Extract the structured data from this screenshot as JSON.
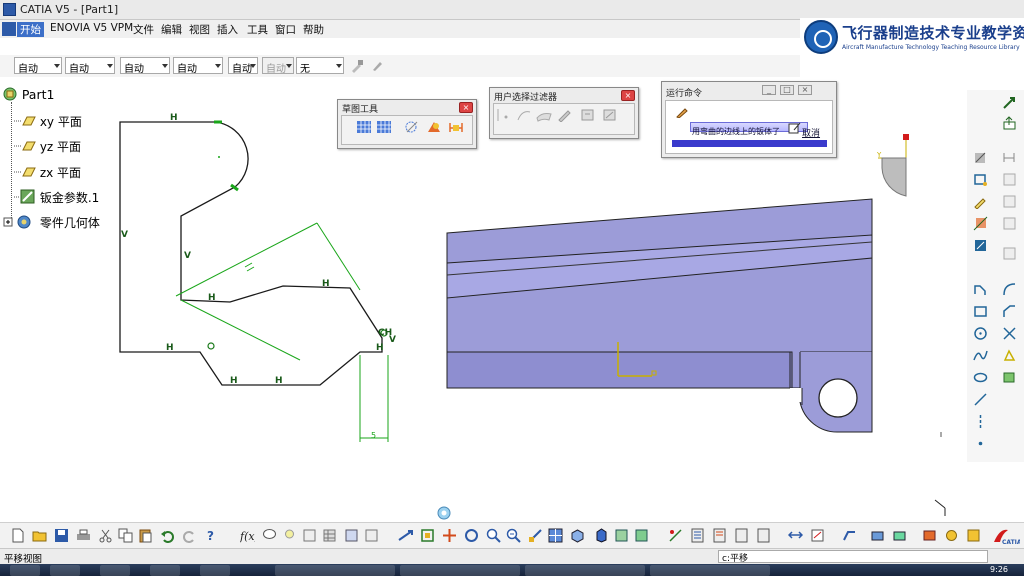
{
  "window": {
    "title": "CATIA V5 - [Part1]"
  },
  "menu": {
    "items": [
      "开始",
      "ENOVIA V5 VPM",
      "文件",
      "编辑",
      "视图",
      "插入",
      "工具",
      "窗口",
      "帮助"
    ]
  },
  "logo": {
    "text_cn": "飞行器制造技术专业教学资源库",
    "text_en": "Aircraft Manufacture Technology Teaching Resource Library"
  },
  "toolbar_top": {
    "combos": [
      "自动",
      "自动",
      "自动",
      "自动",
      "自动",
      "自动",
      "自动",
      "无"
    ]
  },
  "tree": {
    "root": "Part1",
    "items": [
      "xy 平面",
      "yz 平面",
      "zx 平面",
      "钣金参数.1",
      "零件几何体"
    ]
  },
  "sketch_tools": {
    "title": "草图工具"
  },
  "user_filter": {
    "title": "用户选择过滤器"
  },
  "run_command": {
    "title": "运行命令",
    "progress_text": "用弯曲的边线上的钣体了",
    "cancel_label": "取消"
  },
  "sketch": {
    "constraint_labels": [
      "H",
      "V",
      "V",
      "H",
      "H",
      "H",
      "H",
      "H",
      "H",
      "V",
      "H",
      "CH"
    ],
    "dimension": "5"
  },
  "statusbar": {
    "left_text": "平移视图",
    "command_text": "c:平移"
  },
  "taskbar": {
    "clock": "9:26"
  },
  "colors": {
    "part_face": "#9c9cd8",
    "part_face_dark": "#8a8ac8",
    "sketch_line": "#1a1a1a",
    "dimension_green": "#1aa61a",
    "menu_highlight": "#3c6fc8"
  }
}
